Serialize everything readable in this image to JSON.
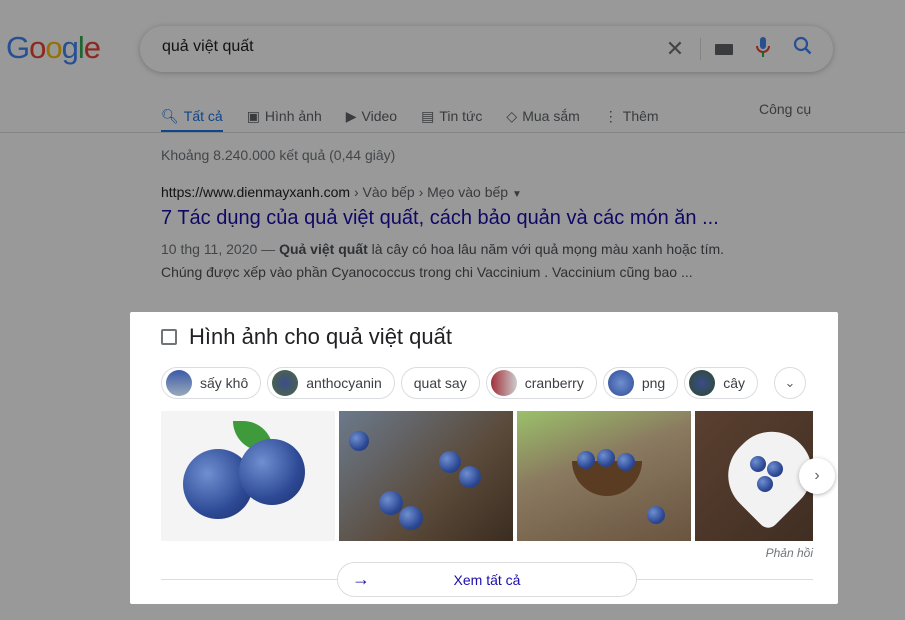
{
  "logo": "Google",
  "search": {
    "query": "quả việt quất"
  },
  "tabs": [
    {
      "label": "Tất cả",
      "icon": "search-icon",
      "active": true
    },
    {
      "label": "Hình ảnh",
      "icon": "image-icon"
    },
    {
      "label": "Video",
      "icon": "play-icon"
    },
    {
      "label": "Tin tức",
      "icon": "news-icon"
    },
    {
      "label": "Mua sắm",
      "icon": "tag-icon"
    },
    {
      "label": "Thêm",
      "icon": "more-vert-icon"
    }
  ],
  "tools": "Công cụ",
  "stats": "Khoảng 8.240.000 kết quả (0,44 giây)",
  "result": {
    "url": "https://www.dienmayxanh.com",
    "crumbs": " › Vào bếp › Mẹo vào bếp",
    "title": "7 Tác dụng của quả việt quất, cách bảo quản và các món ăn ...",
    "date": "10 thg 11, 2020 — ",
    "bold": "Quả việt quất",
    "snip1": " là cây có hoa lâu năm với quả mọng màu xanh hoặc tím.",
    "snip2": "Chúng được xếp vào phần Cyanococcus trong chi Vaccinium . Vaccinium cũng bao ..."
  },
  "panel": {
    "title": "Hình ảnh cho quả việt quất",
    "chips": [
      "sấy khô",
      "anthocyanin",
      "quat say",
      "cranberry",
      "png",
      "cây"
    ],
    "feedback": "Phản hồi",
    "see_all": "Xem tất cả"
  },
  "colors": {
    "link": "#1a0dab",
    "accent": "#1a73e8"
  }
}
